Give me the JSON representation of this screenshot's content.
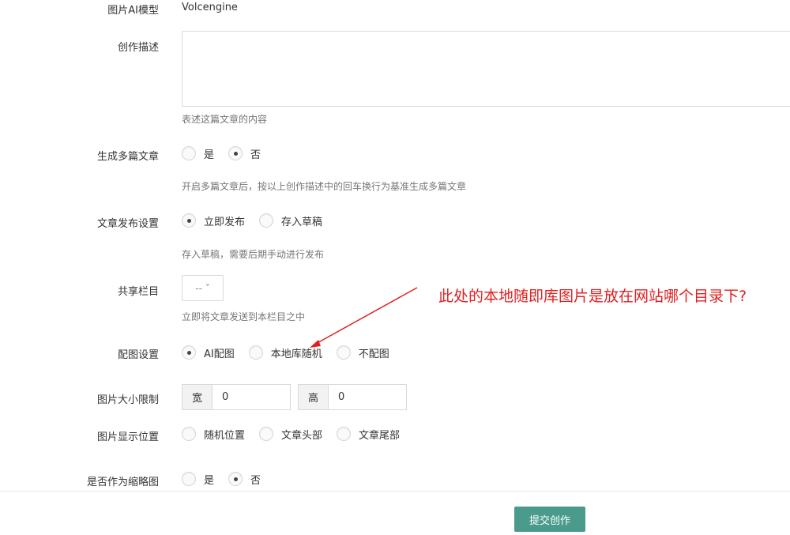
{
  "form": {
    "ai_model": {
      "label": "图片AI模型",
      "value": "Volcengine"
    },
    "description": {
      "label": "创作描述",
      "value": "",
      "hint": "表述这篇文章的内容"
    },
    "multi_article": {
      "label": "生成多篇文章",
      "options": [
        {
          "label": "是",
          "checked": false
        },
        {
          "label": "否",
          "checked": true
        }
      ],
      "hint": "开启多篇文章后，按以上创作描述中的回车换行为基准生成多篇文章"
    },
    "publish_setting": {
      "label": "文章发布设置",
      "options": [
        {
          "label": "立即发布",
          "checked": true
        },
        {
          "label": "存入草稿",
          "checked": false
        }
      ],
      "hint": "存入草稿，需要后期手动进行发布"
    },
    "shared_column": {
      "label": "共享栏目",
      "selected": "-- ˅",
      "hint": "立即将文章发送到本栏目之中"
    },
    "image_setting": {
      "label": "配图设置",
      "options": [
        {
          "label": "AI配图",
          "checked": true
        },
        {
          "label": "本地库随机",
          "checked": false
        },
        {
          "label": "不配图",
          "checked": false
        }
      ]
    },
    "image_size": {
      "label": "图片大小限制",
      "width_addon": "宽",
      "width_value": "0",
      "height_addon": "高",
      "height_value": "0"
    },
    "image_position": {
      "label": "图片显示位置",
      "options": [
        {
          "label": "随机位置",
          "checked": false
        },
        {
          "label": "文章头部",
          "checked": false
        },
        {
          "label": "文章尾部",
          "checked": false
        }
      ]
    },
    "thumbnail": {
      "label": "是否作为缩略图",
      "options": [
        {
          "label": "是",
          "checked": false
        },
        {
          "label": "否",
          "checked": true
        }
      ]
    },
    "submit_label": "提交创作"
  },
  "annotation": {
    "text": "此处的本地随即库图片是放在网站哪个目录下?",
    "color": "#e02020"
  },
  "colors": {
    "primary_button": "#4a9b8c",
    "border": "#d9d9d9",
    "hint_text": "#777777"
  }
}
